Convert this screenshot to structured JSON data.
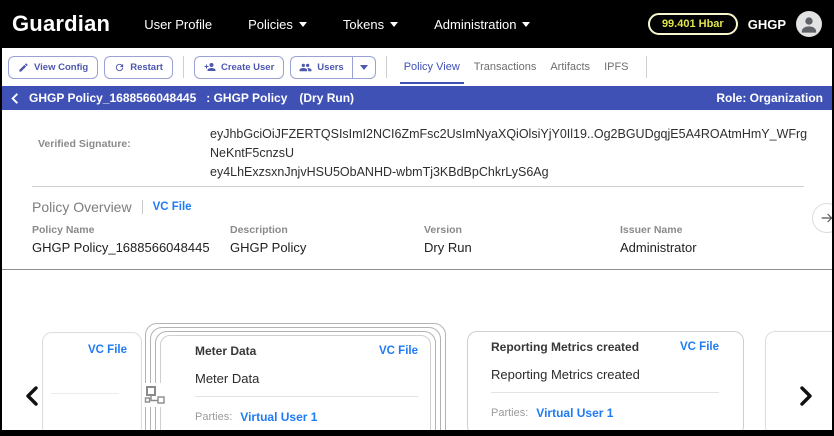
{
  "colors": {
    "accent_indigo": "#3f51b5",
    "link_blue": "#1e7bf4",
    "hbar_yellow": "#e0e34c",
    "topbar_black": "#000000"
  },
  "navbar": {
    "brand": "Guardian",
    "items": [
      {
        "label": "User Profile",
        "caret": false
      },
      {
        "label": "Policies",
        "caret": true
      },
      {
        "label": "Tokens",
        "caret": true
      },
      {
        "label": "Administration",
        "caret": true
      }
    ],
    "balance": "99.401 Hbar",
    "account": "GHGP"
  },
  "toolbar": {
    "view_config": "View Config",
    "restart": "Restart",
    "create_user": "Create User",
    "users": "Users",
    "tabs": [
      {
        "label": "Policy View",
        "active": true
      },
      {
        "label": "Transactions",
        "active": false
      },
      {
        "label": "Artifacts",
        "active": false
      },
      {
        "label": "IPFS",
        "active": false
      }
    ]
  },
  "policy_header": {
    "name": "GHGP Policy_1688566048445",
    "subtitle": ": GHGP Policy",
    "mode": "(Dry Run)",
    "role": "Role: Organization"
  },
  "signature": {
    "label": "Verified Signature:",
    "line1": "eyJhbGciOiJFZERTQSIsImI2NCI6ZmFsc2UsImNyaXQiOlsiYjY0Il19..Og2BGUDgqjE5A4ROAtmHmY_WFrgNeKntF5cnzsU",
    "line2": "ey4LhExzsxnJnjvHSU5ObANHD-wbmTj3KBdBpChkrLyS6Ag"
  },
  "overview": {
    "title": "Policy Overview",
    "vc_file_link": "VC File",
    "fields": [
      {
        "label": "Policy Name",
        "value": "GHGP Policy_1688566048445"
      },
      {
        "label": "Description",
        "value": "GHGP Policy"
      },
      {
        "label": "Version",
        "value": "Dry Run"
      },
      {
        "label": "Issuer Name",
        "value": "Administrator"
      }
    ]
  },
  "carousel": {
    "left_card": {
      "vc_file_link": "VC File"
    },
    "meter_card": {
      "title": "Meter Data",
      "body": "Meter Data",
      "vc_file_link": "VC File",
      "parties_label": "Parties:",
      "party": "Virtual User 1"
    },
    "reporting_card": {
      "title": "Reporting Metrics created",
      "body": "Reporting Metrics created",
      "vc_file_link": "VC File",
      "parties_label": "Parties:",
      "party": "Virtual User 1"
    }
  }
}
